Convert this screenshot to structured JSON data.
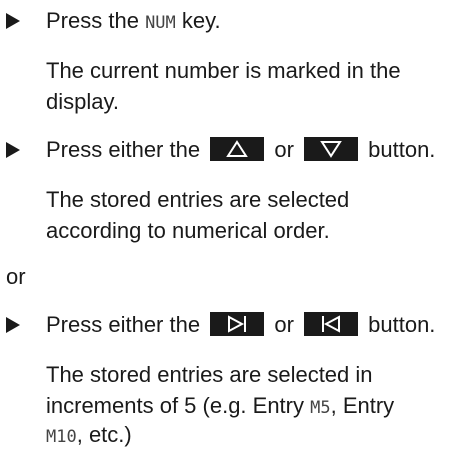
{
  "step1": {
    "prefix": "Press the",
    "key": "NUM",
    "suffix": "key.",
    "result_line1": "The current number is marked in the",
    "result_line2": "display."
  },
  "step2": {
    "prefix": "Press either the",
    "or": "or",
    "suffix": "button.",
    "button_a_icon": "up-triangle-icon",
    "button_b_icon": "down-triangle-icon",
    "result_line1": "The stored entries are selected",
    "result_line2": "according to numerical order."
  },
  "or_text": "or",
  "step3": {
    "prefix": "Press either the",
    "or": "or",
    "suffix": "button.",
    "button_a_icon": "skip-forward-icon",
    "button_b_icon": "skip-back-icon",
    "result_line1": "The stored entries are selected in",
    "result_line2_a": "increments of 5 (e.g. Entry",
    "result_line2_code": "M5",
    "result_line2_b": ", Entry",
    "result_line3_code": "M10",
    "result_line3_b": ", etc.)"
  }
}
